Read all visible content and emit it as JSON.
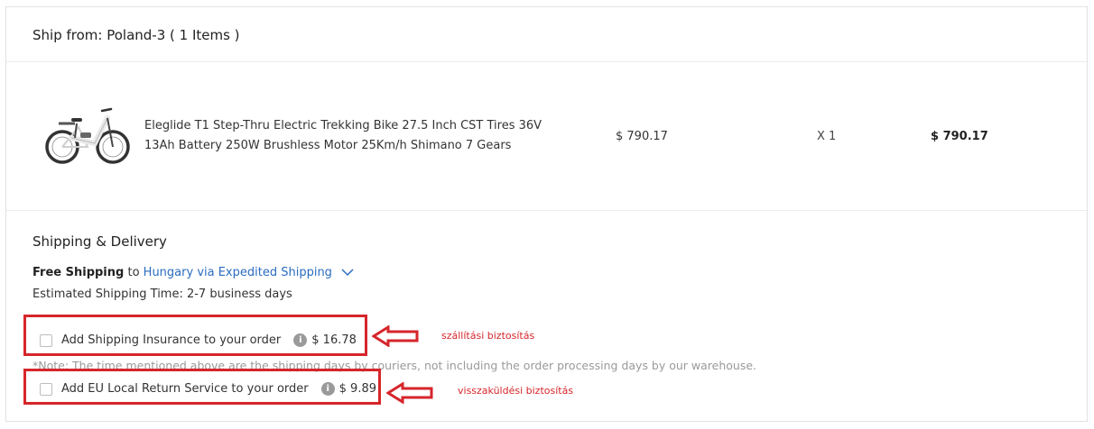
{
  "header": {
    "ship_from": "Ship from: Poland-3 ( 1 Items )"
  },
  "product": {
    "name": "Eleglide T1 Step-Thru Electric Trekking Bike 27.5 Inch CST Tires 36V 13Ah Battery 250W Brushless Motor 25Km/h Shimano 7 Gears",
    "price": "$ 790.17",
    "quantity": "X 1",
    "total": "$ 790.17"
  },
  "shipping": {
    "title": "Shipping & Delivery",
    "free_label": "Free Shipping",
    "to_word": "to",
    "method_link": "Hungary via Expedited Shipping",
    "estimated": "Estimated Shipping Time: 2-7 business days",
    "note": "*Note: The time mentioned above are the shipping days by couriers, not including the order processing days by our warehouse."
  },
  "options": [
    {
      "label": "Add Shipping Insurance to your order",
      "price": "$ 16.78",
      "checked": false
    },
    {
      "label": "Add EU Local Return Service to your order",
      "price": "$ 9.89",
      "checked": false
    }
  ],
  "annotations": {
    "insurance": "szállítási biztosítás",
    "return_service": "visszaküldési biztosítás",
    "color": "#d6262b"
  },
  "icons": {
    "info": "info-icon",
    "chevron": "chevron-down-icon",
    "product_image": "electric-bike-image"
  },
  "colors": {
    "link": "#2b6cbf",
    "annotation": "#d6262b",
    "info_icon": "#9a9a9a"
  }
}
